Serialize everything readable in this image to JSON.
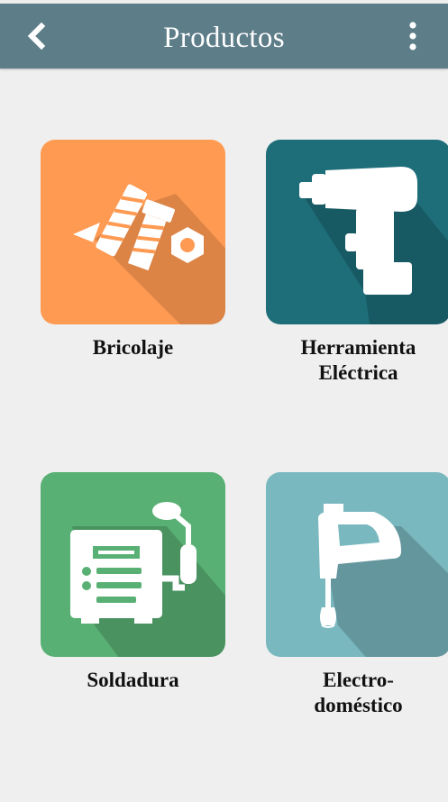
{
  "header": {
    "title": "Productos",
    "back_icon": "chevron-left-icon",
    "menu_icon": "vertical-dots-icon"
  },
  "products": [
    {
      "label_lines": [
        "Bricolaje"
      ],
      "icon": "screw-bolt-nut-icon",
      "color": "#ff9a52"
    },
    {
      "label_lines": [
        "Herramienta",
        "Eléctrica"
      ],
      "icon": "power-drill-icon",
      "color": "#1e6e7a"
    },
    {
      "label_lines": [
        "Soldadura"
      ],
      "icon": "welding-machine-icon",
      "color": "#59b074"
    },
    {
      "label_lines": [
        "Electro-",
        "doméstico"
      ],
      "icon": "hand-mixer-icon",
      "color": "#7ab8c0"
    }
  ]
}
